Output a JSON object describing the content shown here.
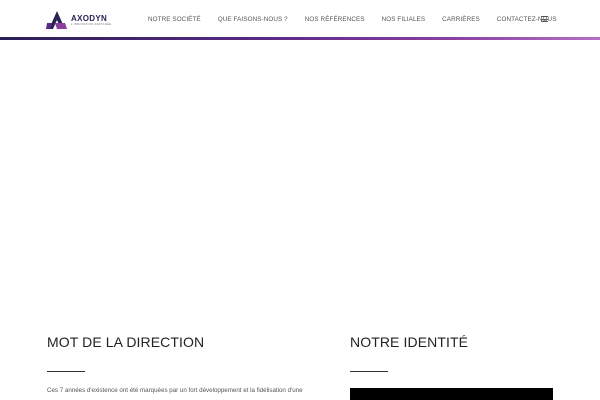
{
  "header": {
    "logo": {
      "name": "AXODYN",
      "tagline": "L'INNOVATION PARTAGÉE",
      "colors": {
        "primary": "#2a2357",
        "accent": "#8a3fa0"
      }
    },
    "nav": [
      {
        "label": "NOTRE SOCIÉTÉ"
      },
      {
        "label": "QUE FAISONS-NOUS ?"
      },
      {
        "label": "NOS RÉFÉRENCES"
      },
      {
        "label": "NOS FILIALES"
      },
      {
        "label": "CARRIÈRES"
      },
      {
        "label": "CONTACTEZ-NOUS"
      }
    ],
    "menu_icon": "hamburger-menu-icon"
  },
  "sections": {
    "direction": {
      "title": "MOT DE LA DIRECTION",
      "text": "Ces 7 années d'existence ont été marquées par un fort développement et la fidélisation d'une"
    },
    "identity": {
      "title": "NOTRE IDENTITÉ"
    }
  }
}
